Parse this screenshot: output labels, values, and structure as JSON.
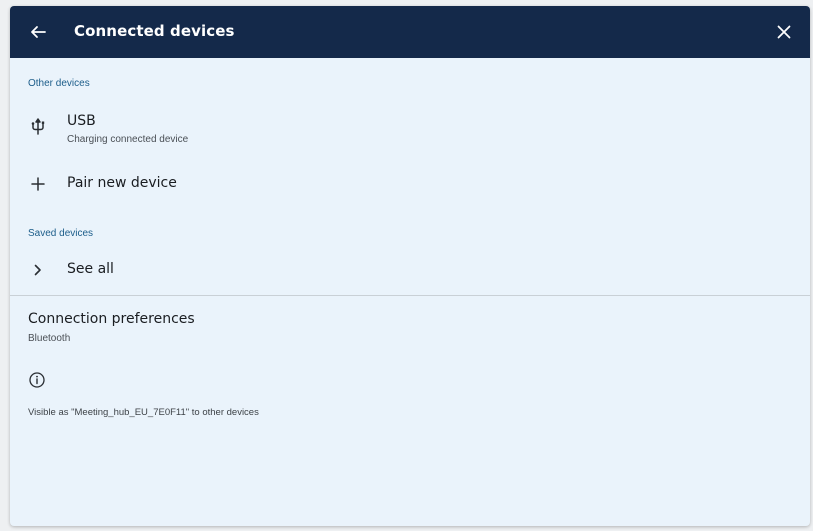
{
  "header": {
    "title": "Connected devices",
    "back_icon": "arrow-back-icon",
    "close_icon": "close-icon",
    "background_color": "#14294a"
  },
  "other_devices": {
    "header": "Other devices",
    "usb": {
      "icon": "usb-icon",
      "title": "USB",
      "subtitle": "Charging connected device"
    },
    "pair_new": {
      "icon": "plus-icon",
      "title": "Pair new device"
    }
  },
  "saved_devices": {
    "header": "Saved devices",
    "see_all": {
      "icon": "chevron-right-icon",
      "title": "See all"
    }
  },
  "connection_preferences": {
    "title": "Connection preferences",
    "subtitle": "Bluetooth"
  },
  "info": {
    "icon": "info-icon",
    "text": "Visible as \"Meeting_hub_EU_7E0F11\" to other devices"
  },
  "colors": {
    "accent": "#1c5d8a",
    "panel_background": "#eaf3fb"
  }
}
